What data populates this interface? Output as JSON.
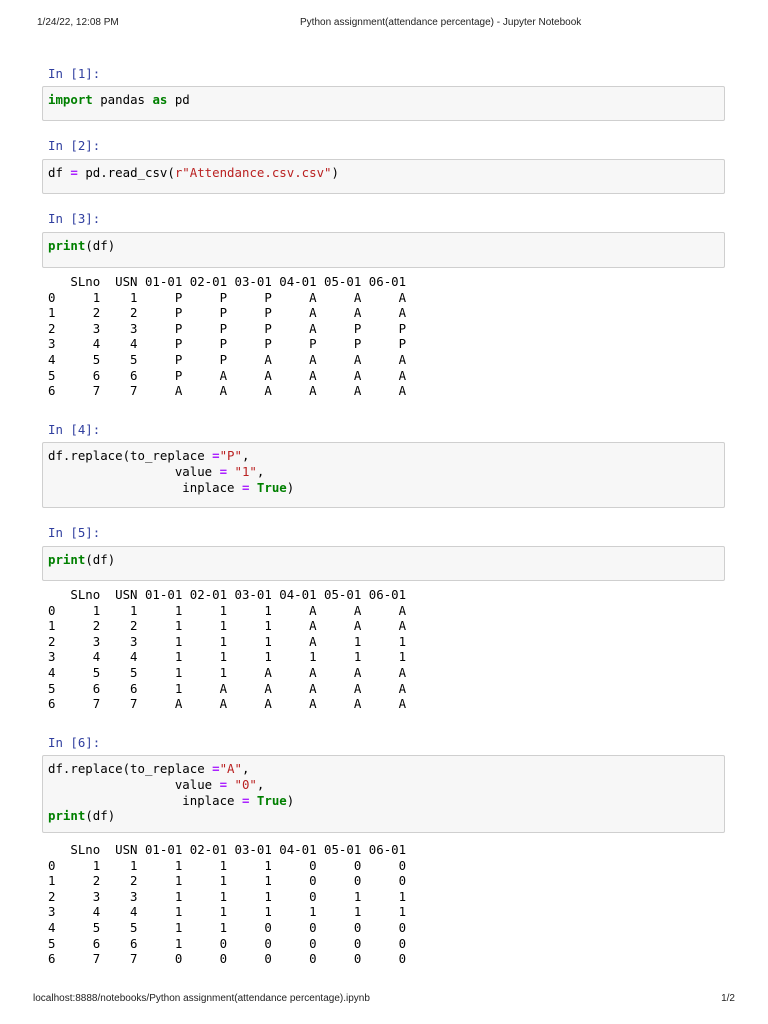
{
  "page_header": {
    "datetime": "1/24/22, 12:08 PM",
    "title": "Python assignment(attendance percentage) - Jupyter Notebook"
  },
  "page_footer": {
    "url": "localhost:8888/notebooks/Python assignment(attendance percentage).ipynb",
    "page": "1/2"
  },
  "colors": {
    "prompt": "#303F9F",
    "keyword": "#008000",
    "string": "#BA2121",
    "operator": "#AA22FF",
    "cell_bg": "#f7f7f7",
    "cell_border": "#cfcfcf"
  },
  "cells": [
    {
      "prompt": "In [1]:",
      "code": [
        [
          [
            "import",
            "kw"
          ],
          [
            " pandas ",
            "nm"
          ],
          [
            "as",
            "kw"
          ],
          [
            " pd",
            "nm"
          ]
        ]
      ],
      "output": []
    },
    {
      "prompt": "In [2]:",
      "code": [
        [
          [
            "df ",
            "nm"
          ],
          [
            "=",
            "op"
          ],
          [
            " pd.read_csv(",
            "nm"
          ],
          [
            "r\"Attendance.csv.csv\"",
            "str"
          ],
          [
            ")",
            "nm"
          ]
        ]
      ],
      "output": []
    },
    {
      "prompt": "In [3]:",
      "code": [
        [
          [
            "print",
            "kw"
          ],
          [
            "(df)",
            "nm"
          ]
        ]
      ],
      "output": [
        "   SLno  USN 01-01 02-01 03-01 04-01 05-01 06-01",
        "0     1    1     P     P     P     A     A     A",
        "1     2    2     P     P     P     A     A     A",
        "2     3    3     P     P     P     A     P     P",
        "3     4    4     P     P     P     P     P     P",
        "4     5    5     P     P     A     A     A     A",
        "5     6    6     P     A     A     A     A     A",
        "6     7    7     A     A     A     A     A     A"
      ]
    },
    {
      "prompt": "In [4]:",
      "code": [
        [
          [
            "df.replace(to_replace ",
            "nm"
          ],
          [
            "=",
            "op"
          ],
          [
            "\"P\"",
            "str"
          ],
          [
            ",",
            "nm"
          ]
        ],
        [
          [
            "                 value ",
            "nm"
          ],
          [
            "=",
            "op"
          ],
          [
            " ",
            "nm"
          ],
          [
            "\"1\"",
            "str"
          ],
          [
            ",",
            "nm"
          ]
        ],
        [
          [
            "                  inplace ",
            "nm"
          ],
          [
            "=",
            "op"
          ],
          [
            " ",
            "nm"
          ],
          [
            "True",
            "kw"
          ],
          [
            ")",
            "nm"
          ]
        ]
      ],
      "output": []
    },
    {
      "prompt": "In [5]:",
      "code": [
        [
          [
            "print",
            "kw"
          ],
          [
            "(df)",
            "nm"
          ]
        ]
      ],
      "output": [
        "   SLno  USN 01-01 02-01 03-01 04-01 05-01 06-01",
        "0     1    1     1     1     1     A     A     A",
        "1     2    2     1     1     1     A     A     A",
        "2     3    3     1     1     1     A     1     1",
        "3     4    4     1     1     1     1     1     1",
        "4     5    5     1     1     A     A     A     A",
        "5     6    6     1     A     A     A     A     A",
        "6     7    7     A     A     A     A     A     A"
      ]
    },
    {
      "prompt": "In [6]:",
      "code": [
        [
          [
            "df.replace(to_replace ",
            "nm"
          ],
          [
            "=",
            "op"
          ],
          [
            "\"A\"",
            "str"
          ],
          [
            ",",
            "nm"
          ]
        ],
        [
          [
            "                 value ",
            "nm"
          ],
          [
            "=",
            "op"
          ],
          [
            " ",
            "nm"
          ],
          [
            "\"0\"",
            "str"
          ],
          [
            ",",
            "nm"
          ]
        ],
        [
          [
            "                  inplace ",
            "nm"
          ],
          [
            "=",
            "op"
          ],
          [
            " ",
            "nm"
          ],
          [
            "True",
            "kw"
          ],
          [
            ")",
            "nm"
          ]
        ],
        [
          [
            "print",
            "kw"
          ],
          [
            "(df)",
            "nm"
          ]
        ]
      ],
      "output": [
        "   SLno  USN 01-01 02-01 03-01 04-01 05-01 06-01",
        "0     1    1     1     1     1     0     0     0",
        "1     2    2     1     1     1     0     0     0",
        "2     3    3     1     1     1     0     1     1",
        "3     4    4     1     1     1     1     1     1",
        "4     5    5     1     1     0     0     0     0",
        "5     6    6     1     0     0     0     0     0",
        "6     7    7     0     0     0     0     0     0"
      ]
    }
  ]
}
